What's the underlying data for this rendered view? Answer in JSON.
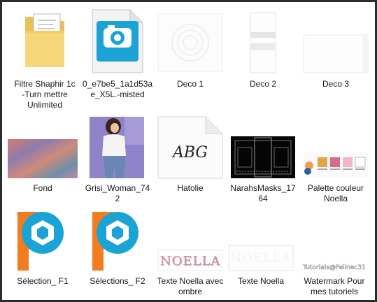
{
  "files": [
    {
      "label": "Filtre Shaphir 1c\n-Turn  mettre\nUnlimited",
      "icon": "folder-with-documents-icon"
    },
    {
      "label": "0_e7be5_1a1d53a\ne_X5L.-misted",
      "icon": "psp-image-file-icon"
    },
    {
      "label": "Deco 1",
      "icon": "deco-image-thumbnail"
    },
    {
      "label": "Deco 2",
      "icon": "deco-image-thumbnail"
    },
    {
      "label": "Deco 3",
      "icon": "deco-image-thumbnail"
    },
    {
      "label": "Fond",
      "icon": "gradient-background-thumbnail"
    },
    {
      "label": "Grisi_Woman_74\n2",
      "icon": "woman-tube-thumbnail"
    },
    {
      "label": "Hatolie",
      "icon": "font-file-icon"
    },
    {
      "label": "NarahsMasks_17\n64",
      "icon": "mask-thumbnail"
    },
    {
      "label": "Palette couleur\nNoella",
      "icon": "color-palette-thumbnail"
    },
    {
      "label": "Sélection_ F1",
      "icon": "psp-selection-file-icon"
    },
    {
      "label": "Sélections_ F2",
      "icon": "psp-selection-file-icon"
    },
    {
      "label": "Texte Noella avec\nombre",
      "icon": "text-image-thumbnail"
    },
    {
      "label": "Texte Noella",
      "icon": "text-image-thumbnail"
    },
    {
      "label": "Watermark Pour\nmes tutoriels",
      "icon": "watermark-thumbnail"
    }
  ],
  "hatolie_sample": "ABG",
  "noella_text": "NOELLA",
  "watermark_text": "Tutorials@Felinec31",
  "colors": {
    "frame": "#2b2b2b",
    "psp_blue": "#1aa3d4",
    "psp_orange": "#f47c20",
    "noella_pink": "#d98aa8"
  }
}
